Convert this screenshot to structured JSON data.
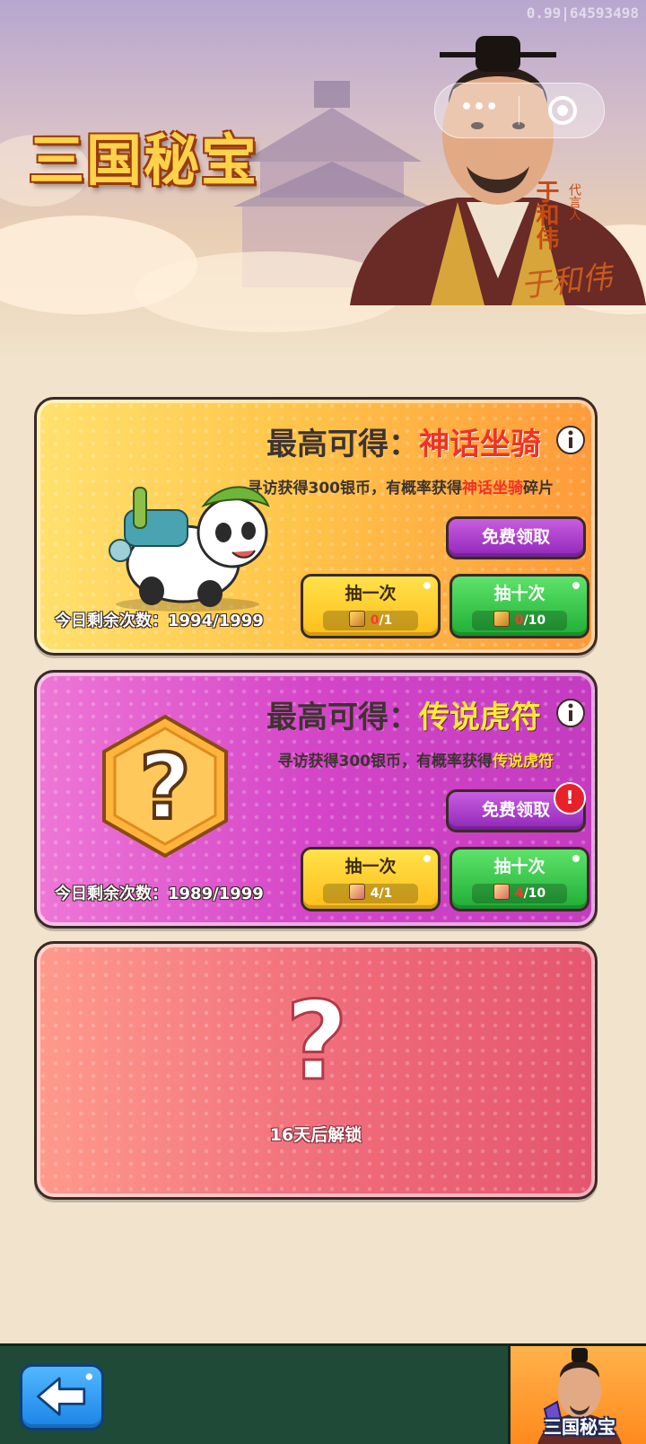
{
  "status": {
    "version_text": "0.99|64593498"
  },
  "banner": {
    "game_title": "三国秘宝",
    "endorser_name": "于和伟",
    "endorser_role": "代言人",
    "signature": "于和伟"
  },
  "mini_program_capsule": {
    "more_icon": "more-dots-icon",
    "close_icon": "close-circle-icon"
  },
  "cards": [
    {
      "headline_prefix": "最高可得：",
      "headline_reward": "神话坐骑",
      "desc_prefix": "寻访获得300银币，有概率获得",
      "desc_reward": "神话坐骑",
      "desc_suffix": "碎片",
      "free_button": "免费领取",
      "draw_one": {
        "label": "抽一次",
        "owned": "0",
        "need": "/1"
      },
      "draw_ten": {
        "label": "抽十次",
        "owned": "0",
        "need": "/10"
      },
      "remaining": "今日剩余次数：1994/1999",
      "accent_color": "#ef3326"
    },
    {
      "headline_prefix": "最高可得：",
      "headline_reward": "传说虎符",
      "desc_prefix": "寻访获得300银币，有概率获得",
      "desc_reward": "传说虎符",
      "desc_suffix": "",
      "free_button": "免费领取",
      "alert_badge": "!",
      "draw_one": {
        "label": "抽一次",
        "owned": "4",
        "need": "/1"
      },
      "draw_ten": {
        "label": "抽十次",
        "owned": "4",
        "need": "/10"
      },
      "remaining": "今日剩余次数：1989/1999",
      "accent_color": "#ffe21e"
    },
    {
      "locked_symbol": "?",
      "unlock_text": "16天后解锁"
    }
  ],
  "footer": {
    "tab_label": "三国秘宝",
    "back_icon": "back-arrow-icon"
  }
}
